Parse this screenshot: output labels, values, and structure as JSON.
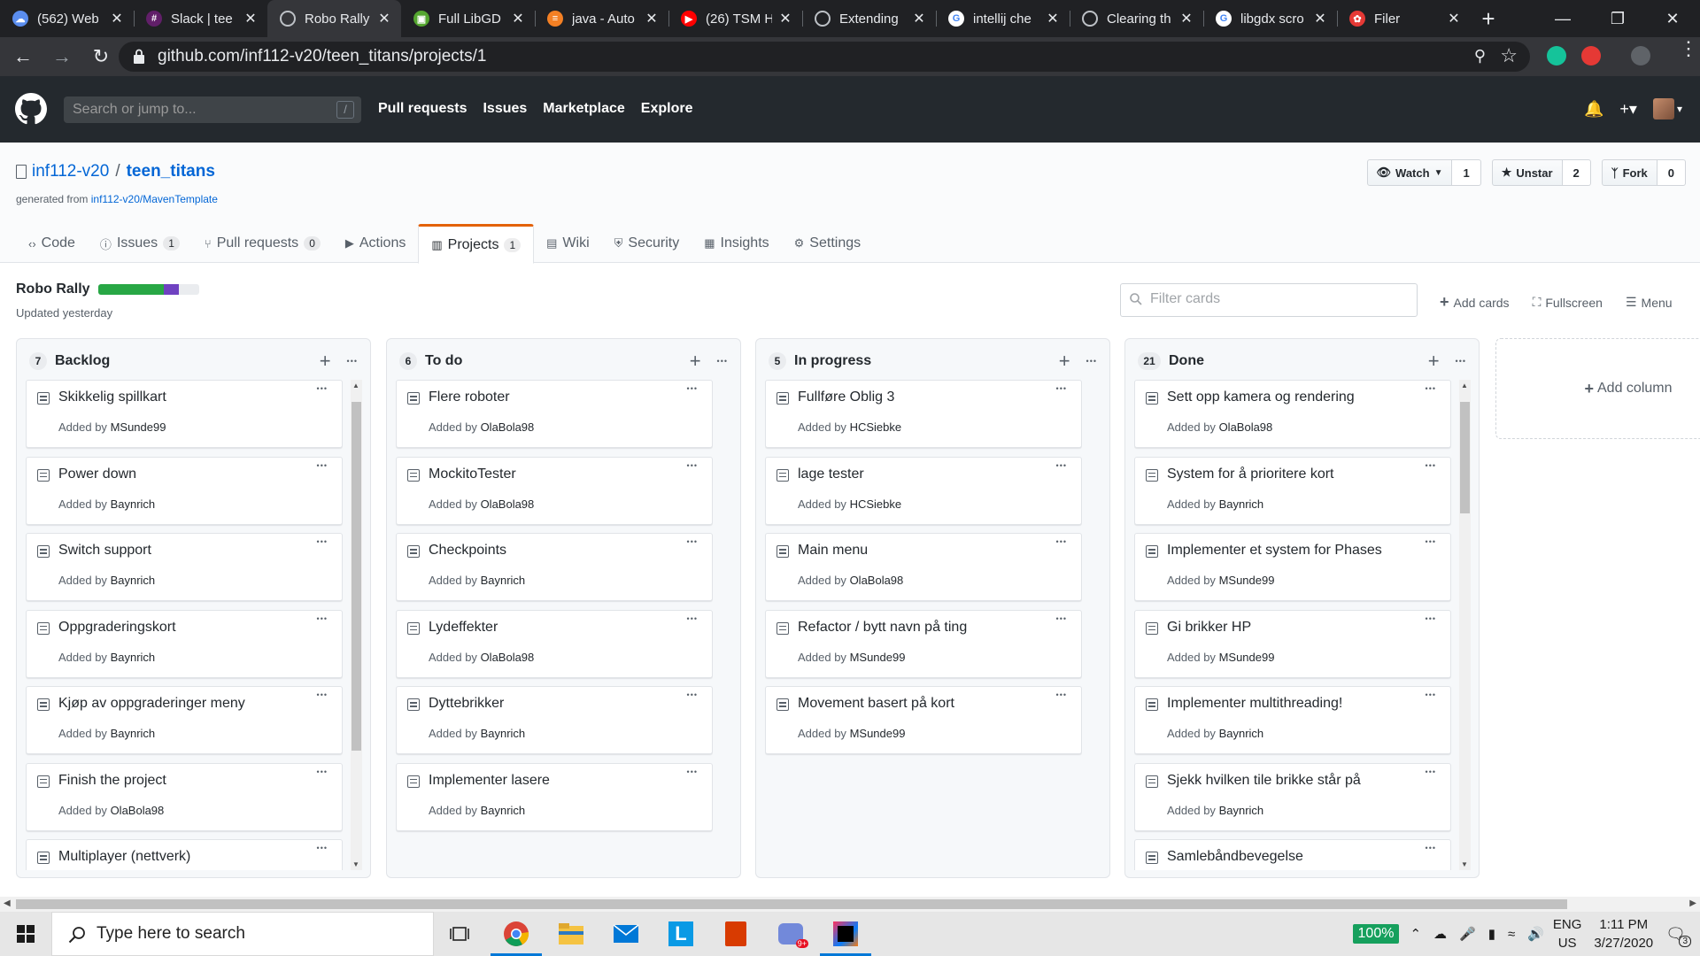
{
  "browser": {
    "tabs": [
      {
        "title": "(562) Web",
        "color": "#5a8dee",
        "glyph": "☁",
        "active": false
      },
      {
        "title": "Slack | tee",
        "color": "#611f69",
        "glyph": "#",
        "active": false
      },
      {
        "title": "Robo Rally",
        "color": "#35363a",
        "glyph": "",
        "active": true
      },
      {
        "title": "Full LibGD",
        "color": "#55a630",
        "glyph": "▣",
        "active": false
      },
      {
        "title": "java - Auto",
        "color": "#f48024",
        "glyph": "≡",
        "active": false
      },
      {
        "title": "(26) TSM H",
        "color": "#ff0000",
        "glyph": "▶",
        "active": false
      },
      {
        "title": "Extending",
        "color": "#202124",
        "glyph": "",
        "active": false
      },
      {
        "title": "intellij che",
        "color": "#ffffff",
        "glyph": "G",
        "active": false
      },
      {
        "title": "Clearing th",
        "color": "#202124",
        "glyph": "",
        "active": false
      },
      {
        "title": "libgdx scro",
        "color": "#ffffff",
        "glyph": "G",
        "active": false
      },
      {
        "title": "Filer",
        "color": "#e53935",
        "glyph": "✿",
        "active": false
      }
    ],
    "new_tab": "+",
    "url": "github.com/inf112-v20/teen_titans/projects/1"
  },
  "github": {
    "search_placeholder": "Search or jump to...",
    "search_key": "/",
    "nav": [
      "Pull requests",
      "Issues",
      "Marketplace",
      "Explore"
    ],
    "repo_owner": "inf112-v20",
    "repo_sep": "/",
    "repo_name": "teen_titans",
    "generated_from_label": "generated from",
    "generated_from_link": "inf112-v20/MavenTemplate",
    "watch_label": "Watch",
    "watch_count": "1",
    "star_label": "Unstar",
    "star_count": "2",
    "fork_label": "Fork",
    "fork_count": "0",
    "tabs": [
      {
        "label": "Code",
        "count": null,
        "icon": "code-icon"
      },
      {
        "label": "Issues",
        "count": "1",
        "icon": "issue-icon"
      },
      {
        "label": "Pull requests",
        "count": "0",
        "icon": "pull-request-icon"
      },
      {
        "label": "Actions",
        "count": null,
        "icon": "play-icon"
      },
      {
        "label": "Projects",
        "count": "1",
        "icon": "project-icon",
        "selected": true
      },
      {
        "label": "Wiki",
        "count": null,
        "icon": "book-icon"
      },
      {
        "label": "Security",
        "count": null,
        "icon": "shield-icon"
      },
      {
        "label": "Insights",
        "count": null,
        "icon": "graph-icon"
      },
      {
        "label": "Settings",
        "count": null,
        "icon": "gear-icon"
      }
    ]
  },
  "project": {
    "title": "Robo Rally",
    "updated": "Updated yesterday",
    "progress": {
      "done_pct": 65,
      "in_progress_pct": 15,
      "done_color": "#28a745",
      "in_progress_color": "#6f42c1"
    },
    "filter_placeholder": "Filter cards",
    "add_cards": "Add cards",
    "fullscreen": "Fullscreen",
    "menu": "Menu",
    "add_column": "Add column",
    "added_by_prefix": "Added by",
    "columns": [
      {
        "name": "Backlog",
        "count": "7",
        "cards": [
          {
            "title": "Skikkelig spillkart",
            "author": "MSunde99"
          },
          {
            "title": "Power down",
            "author": "Baynrich"
          },
          {
            "title": "Switch support",
            "author": "Baynrich"
          },
          {
            "title": "Oppgraderingskort",
            "author": "Baynrich"
          },
          {
            "title": "Kjøp av oppgraderinger meny",
            "author": "Baynrich"
          },
          {
            "title": "Finish the project",
            "author": "OlaBola98"
          },
          {
            "title": "Multiplayer (nettverk)",
            "author": ""
          }
        ],
        "scroll": {
          "thumb_start": 0.02,
          "thumb_size": 0.75
        }
      },
      {
        "name": "To do",
        "count": "6",
        "cards": [
          {
            "title": "Flere roboter",
            "author": "OlaBola98"
          },
          {
            "title": "MockitoTester",
            "author": "OlaBola98"
          },
          {
            "title": "Checkpoints",
            "author": "Baynrich"
          },
          {
            "title": "Lydeffekter",
            "author": "OlaBola98"
          },
          {
            "title": "Dyttebrikker",
            "author": "Baynrich"
          },
          {
            "title": "Implementer lasere",
            "author": "Baynrich"
          }
        ],
        "scroll": null
      },
      {
        "name": "In progress",
        "count": "5",
        "cards": [
          {
            "title": "Fullføre Oblig 3",
            "author": "HCSiebke"
          },
          {
            "title": "lage tester",
            "author": "HCSiebke"
          },
          {
            "title": "Main menu",
            "author": "OlaBola98"
          },
          {
            "title": "Refactor / bytt navn på ting",
            "author": "MSunde99"
          },
          {
            "title": "Movement basert på kort",
            "author": "MSunde99"
          }
        ],
        "scroll": null
      },
      {
        "name": "Done",
        "count": "21",
        "cards": [
          {
            "title": "Sett opp kamera og rendering",
            "author": "OlaBola98"
          },
          {
            "title": "System for å prioritere kort",
            "author": "Baynrich"
          },
          {
            "title": "Implementer et system for Phases",
            "author": "MSunde99"
          },
          {
            "title": "Gi brikker HP",
            "author": "MSunde99"
          },
          {
            "title": "Implementer multithreading!",
            "author": "Baynrich"
          },
          {
            "title": "Sjekk hvilken tile brikke står på",
            "author": "Baynrich"
          },
          {
            "title": "Samlebåndbevegelse",
            "author": ""
          }
        ],
        "scroll": {
          "thumb_start": 0.02,
          "thumb_size": 0.24
        }
      }
    ]
  },
  "taskbar": {
    "search_placeholder": "Type here to search",
    "battery": "100%",
    "lang_top": "ENG",
    "lang_bottom": "US",
    "time": "1:11 PM",
    "date": "3/27/2020",
    "notif_count": "3"
  }
}
